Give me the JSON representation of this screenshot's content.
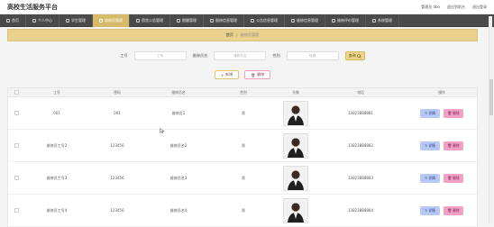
{
  "app": {
    "title": "高校生活服务平台",
    "user_text": "管理员 abo",
    "logout_text": "退出到前台",
    "exit_text": "退出登录"
  },
  "nav": {
    "items": [
      {
        "label": "首页",
        "icon": "home-icon",
        "active": false
      },
      {
        "label": "个人中心",
        "icon": "user-icon",
        "active": false
      },
      {
        "label": "学生管理",
        "icon": "student-icon",
        "active": false
      },
      {
        "label": "维修员管理",
        "icon": "tool-icon",
        "active": true
      },
      {
        "label": "宿舍公告管理",
        "icon": "notice-icon",
        "active": false
      },
      {
        "label": "跑腿管理",
        "icon": "run-icon",
        "active": false
      },
      {
        "label": "报修信息管理",
        "icon": "repair-icon",
        "active": false
      },
      {
        "label": "公告信息管理",
        "icon": "bullhorn-icon",
        "active": false
      },
      {
        "label": "维修信息管理",
        "icon": "wrench-icon",
        "active": false
      },
      {
        "label": "维修评价管理",
        "icon": "star-icon",
        "active": false
      },
      {
        "label": "系统管理",
        "icon": "gear-icon",
        "active": false
      }
    ]
  },
  "breadcrumb": {
    "home": "首页",
    "current": "维修员管理"
  },
  "filters": {
    "job_no_label": "工号",
    "job_no_placeholder": "工号",
    "name_label": "维修员名",
    "name_placeholder": "维修员名",
    "gender_label": "性别",
    "gender_placeholder": "性别",
    "query_label": "查询"
  },
  "actions": {
    "add_label": "新增",
    "delete_label": "删除"
  },
  "table": {
    "headers": [
      "",
      "工号",
      "密码",
      "维修员名",
      "性别",
      "头像",
      "电话",
      "操作"
    ],
    "rows": [
      {
        "job_no": "001",
        "password": "001",
        "name": "维修员1",
        "gender": "男",
        "phone": "13823888881",
        "view": "详情",
        "delete": "删除",
        "photo": "person-photo"
      },
      {
        "job_no": "维修员工号2",
        "password": "123456",
        "name": "维修员名2",
        "gender": "男",
        "phone": "13823888882",
        "view": "详情",
        "delete": "删除",
        "photo": "person-photo"
      },
      {
        "job_no": "维修员工号3",
        "password": "123456",
        "name": "维修员名3",
        "gender": "男",
        "phone": "13823888883",
        "view": "详情",
        "delete": "删除",
        "photo": "person-photo"
      },
      {
        "job_no": "维修员工号4",
        "password": "123456",
        "name": "维修员名4",
        "gender": "男",
        "phone": "13823888884",
        "view": "详情",
        "delete": "删除",
        "photo": "person-photo"
      }
    ]
  }
}
